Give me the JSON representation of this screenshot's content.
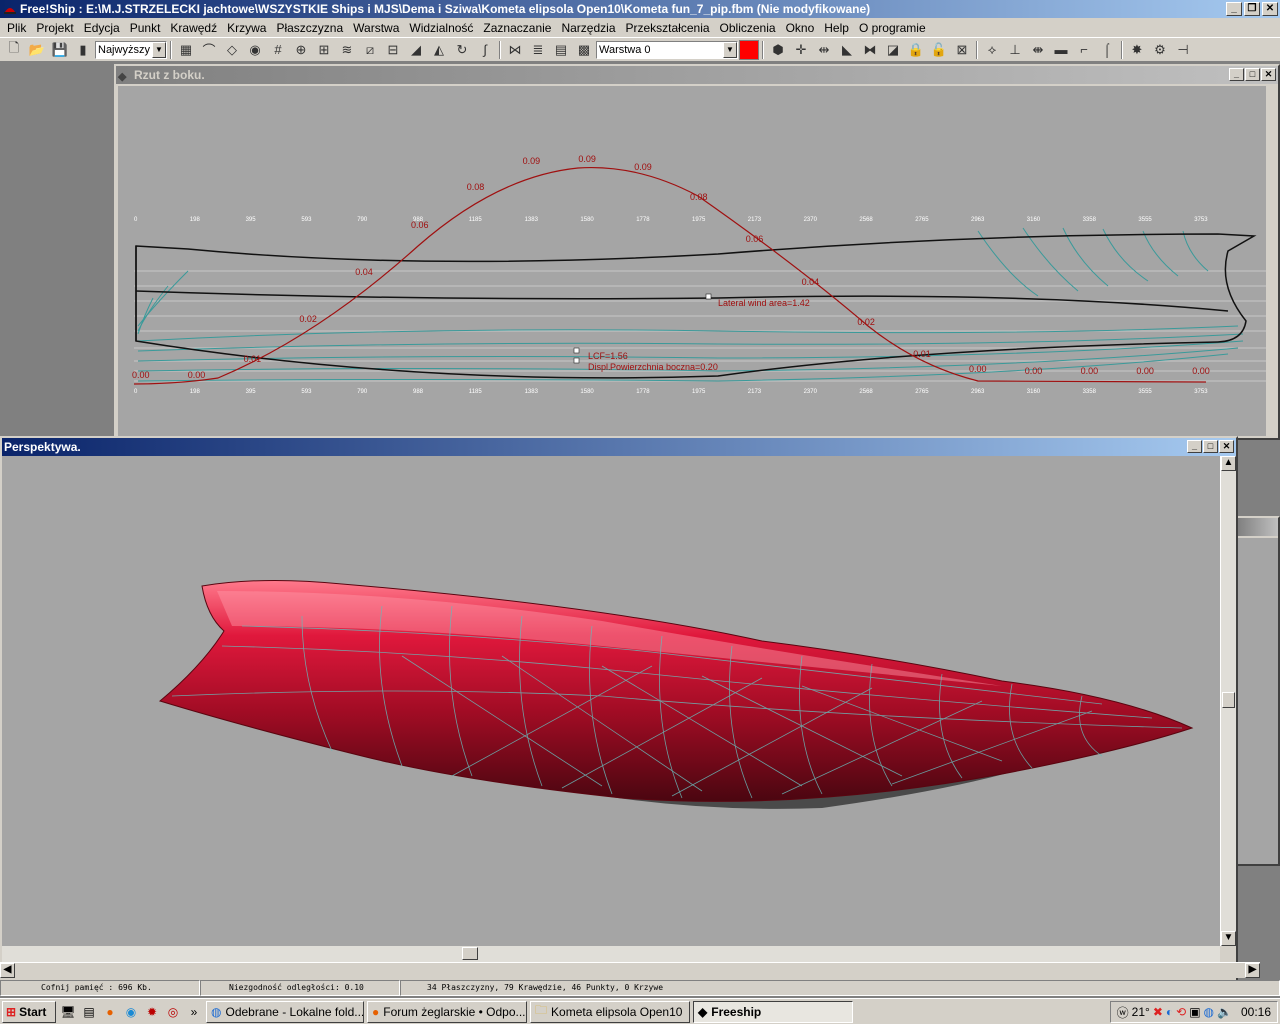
{
  "window": {
    "title": "Free!Ship : E:\\M.J.STRZELECKI jachtowe\\WSZYSTKIE Ships i MJS\\Dema i Sziwa\\Kometa elipsola Open10\\Kometa fun_7_pip.fbm (Nie modyfikowane)"
  },
  "menu": [
    "Plik",
    "Projekt",
    "Edycja",
    "Punkt",
    "Krawędź",
    "Krzywa",
    "Płaszczyzna",
    "Warstwa",
    "Widzialność",
    "Zaznaczanie",
    "Narzędzia",
    "Przekształcenia",
    "Obliczenia",
    "Okno",
    "Help",
    "O programie"
  ],
  "toolbar": {
    "precision_value": "Najwyższy",
    "layer_value": "Warstwa 0",
    "layer_color": "#ff0000"
  },
  "side_view": {
    "title": "Rzut z boku.",
    "ticks": [
      "0",
      "198",
      "395",
      "593",
      "790",
      "988",
      "1185",
      "1383",
      "1580",
      "1778",
      "1975",
      "2173",
      "2370",
      "2568",
      "2765",
      "2963",
      "3160",
      "3358",
      "3555",
      "3753"
    ],
    "curve_labels": [
      "0.00",
      "0.00",
      "0.01",
      "0.02",
      "0.04",
      "0.06",
      "0.08",
      "0.09",
      "0.09",
      "0.09",
      "0.08",
      "0.06",
      "0.04",
      "0.02",
      "0.01",
      "0.00",
      "0.00",
      "0.00",
      "0.00",
      "0.00"
    ],
    "annotation_wind": "Lateral wind area=1.42",
    "annotation_lcf": "LCF=1.56",
    "annotation_disp": "Displ.",
    "annotation_side": "Powierzchnia boczna=0.20"
  },
  "perspective": {
    "title": "Perspektywa."
  },
  "statusbar": {
    "undo": "Cofnij pamięć : 696 Kb.",
    "distance": "Niezgodność odległości: 0.10",
    "counts": "34 Płaszczyzny, 79 Krawędzie, 46 Punkty, 0 Krzywe"
  },
  "taskbar": {
    "start": "Start",
    "tasks": [
      "Odebrane - Lokalne fold...",
      "Forum żeglarskie • Odpo...",
      "Kometa elipsola Open10",
      "Freeship"
    ],
    "tray_temp": "21°",
    "clock": "00:16"
  },
  "colors": {
    "hull": "#c8102e",
    "curve": "#a01010",
    "waterline": "#3a9a9a"
  }
}
